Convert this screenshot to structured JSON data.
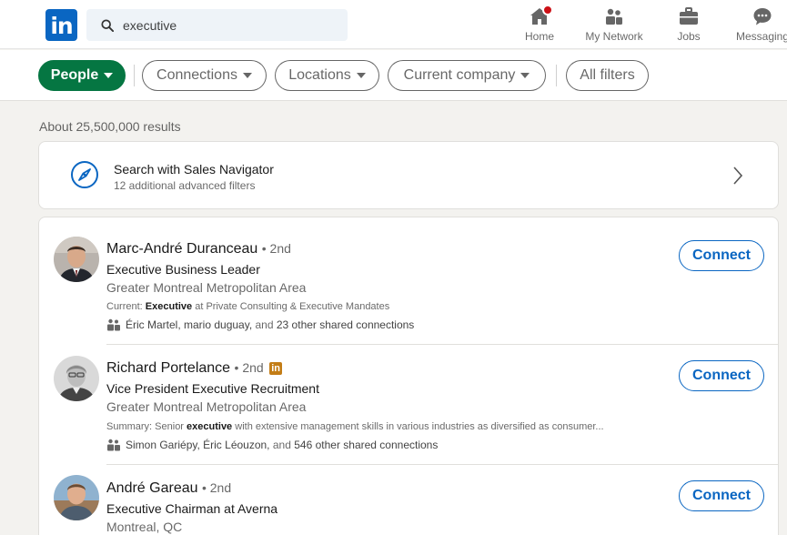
{
  "nav": {
    "logo_text": "in",
    "search": {
      "value": "executive",
      "placeholder": "Search"
    },
    "items": [
      {
        "label": "Home",
        "icon": "home-icon",
        "has_badge": true
      },
      {
        "label": "My Network",
        "icon": "network-icon"
      },
      {
        "label": "Jobs",
        "icon": "briefcase-icon"
      },
      {
        "label": "Messaging",
        "icon": "messaging-icon"
      }
    ]
  },
  "filters": {
    "people": "People",
    "connections": "Connections",
    "locations": "Locations",
    "current_company": "Current company",
    "all_filters": "All filters"
  },
  "results_count": "About 25,500,000 results",
  "sales_navigator": {
    "title": "Search with Sales Navigator",
    "subtitle": "12 additional advanced filters"
  },
  "people": [
    {
      "name": "Marc-André Duranceau",
      "degree": "• 2nd",
      "premium": false,
      "headline": "Executive Business Leader",
      "location": "Greater Montreal Metropolitan Area",
      "snippet_prefix": "Current: ",
      "snippet_keyword": "Executive",
      "snippet_suffix": " at Private Consulting & Executive Mandates",
      "shared_names": "Éric Martel, mario duguay,",
      "shared_mid": " and ",
      "shared_count": "23 other shared connections",
      "connect_label": "Connect"
    },
    {
      "name": "Richard Portelance",
      "degree": "• 2nd",
      "premium": true,
      "premium_label": "in",
      "headline": "Vice President Executive Recruitment",
      "location": "Greater Montreal Metropolitan Area",
      "snippet_prefix": "Summary: Senior ",
      "snippet_keyword": "executive",
      "snippet_suffix": " with extensive management skills in various industries as diversified as consumer...",
      "shared_names": "Simon Gariépy, Éric Léouzon,",
      "shared_mid": " and ",
      "shared_count": "546 other shared connections",
      "connect_label": "Connect"
    },
    {
      "name": "André Gareau",
      "degree": "• 2nd",
      "premium": false,
      "headline": "Executive Chairman at Averna",
      "location": "Montreal, QC",
      "connect_label": "Connect"
    }
  ],
  "colors": {
    "brand_blue": "#0a66c2",
    "active_filter_green": "#057642",
    "notification_red": "#cc1016",
    "premium_gold": "#c37d16"
  }
}
